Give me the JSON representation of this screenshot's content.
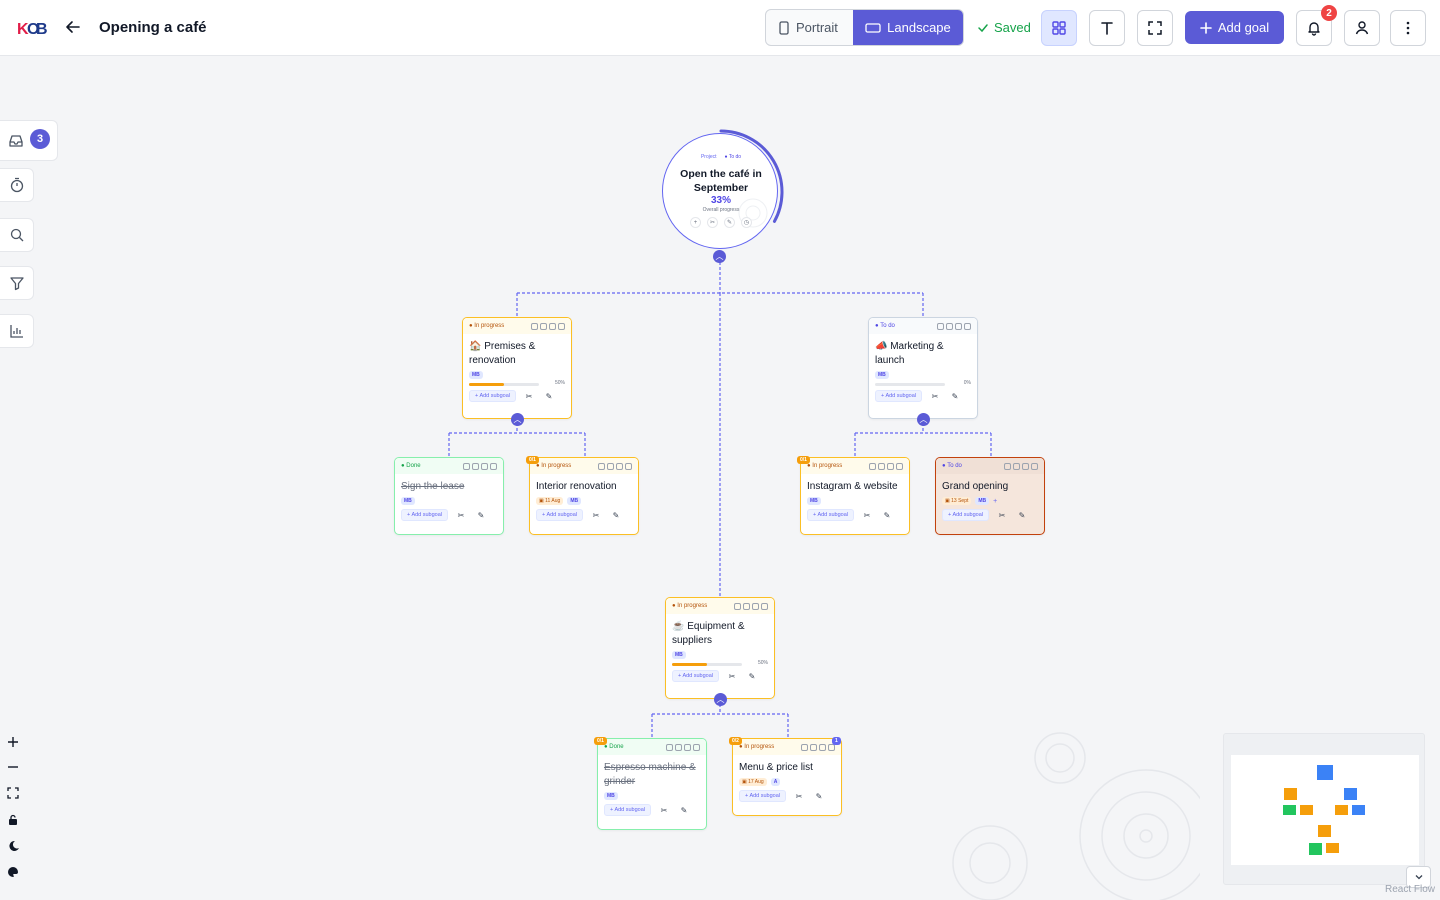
{
  "header": {
    "logo_text": "KOB",
    "title": "Opening a café",
    "view_toggle": {
      "portrait_label": "Portrait",
      "landscape_label": "Landscape",
      "selected": "Landscape"
    },
    "saved_label": "Saved",
    "add_goal_label": "Add goal",
    "notifications_count": "2"
  },
  "sidebar": {
    "inbox_count": "3",
    "items": [
      "inbox-icon",
      "timer-icon",
      "search-icon",
      "filter-icon",
      "chart-icon"
    ]
  },
  "zoom_controls": [
    "zoom-in-icon",
    "zoom-out-icon",
    "fit-view-icon",
    "lock-icon",
    "dark-mode-icon",
    "color-icon"
  ],
  "root": {
    "type_label": "Project",
    "status": "To do",
    "title": "Open the café in September",
    "progress": "33%",
    "progress_value": 0.33,
    "progress_label": "Overall progress"
  },
  "goals": {
    "premises": {
      "status": "In progress",
      "title": "🏠 Premises & renovation",
      "avatar": "MB",
      "progress": "50%",
      "progress_value": 0.5,
      "add_label": "Add subgoal"
    },
    "marketing": {
      "status": "To do",
      "title": "📣 Marketing & launch",
      "avatar": "MB",
      "progress": "0%",
      "progress_value": 0,
      "add_label": "Add subgoal"
    },
    "lease": {
      "status": "Done",
      "title": "Sign the lease",
      "avatar": "MB",
      "add_label": "Add subgoal"
    },
    "interior": {
      "status": "In progress",
      "title": "Interior renovation",
      "count": "0/1",
      "date": "11 Aug",
      "avatar": "MB",
      "add_label": "Add subgoal"
    },
    "instagram": {
      "status": "In progress",
      "title": "Instagram & website",
      "count": "0/1",
      "avatar": "MB",
      "add_label": "Add subgoal"
    },
    "grand": {
      "status": "To do",
      "title": "Grand opening",
      "date": "13 Sept",
      "avatar": "MB",
      "add_label": "Add subgoal"
    },
    "equipment": {
      "status": "In progress",
      "title": "☕ Equipment & suppliers",
      "avatar": "MB",
      "progress": "50%",
      "progress_value": 0.5,
      "add_label": "Add subgoal"
    },
    "espresso": {
      "status": "Done",
      "title": "Espresso machine & grinder",
      "count": "0/1",
      "avatar": "MB",
      "add_label": "Add subgoal"
    },
    "menu": {
      "status": "In progress",
      "title": "Menu & price list",
      "count": "0/2",
      "count_right": "1",
      "date": "17 Aug",
      "avatar": "A",
      "add_label": "Add subgoal"
    }
  },
  "colors": {
    "accent": "#5b5bd6",
    "in_progress": "#f59e0b",
    "done": "#22c55e",
    "todo": "#3b82f6",
    "badge": "#ef4444"
  },
  "attribution": "React Flow"
}
